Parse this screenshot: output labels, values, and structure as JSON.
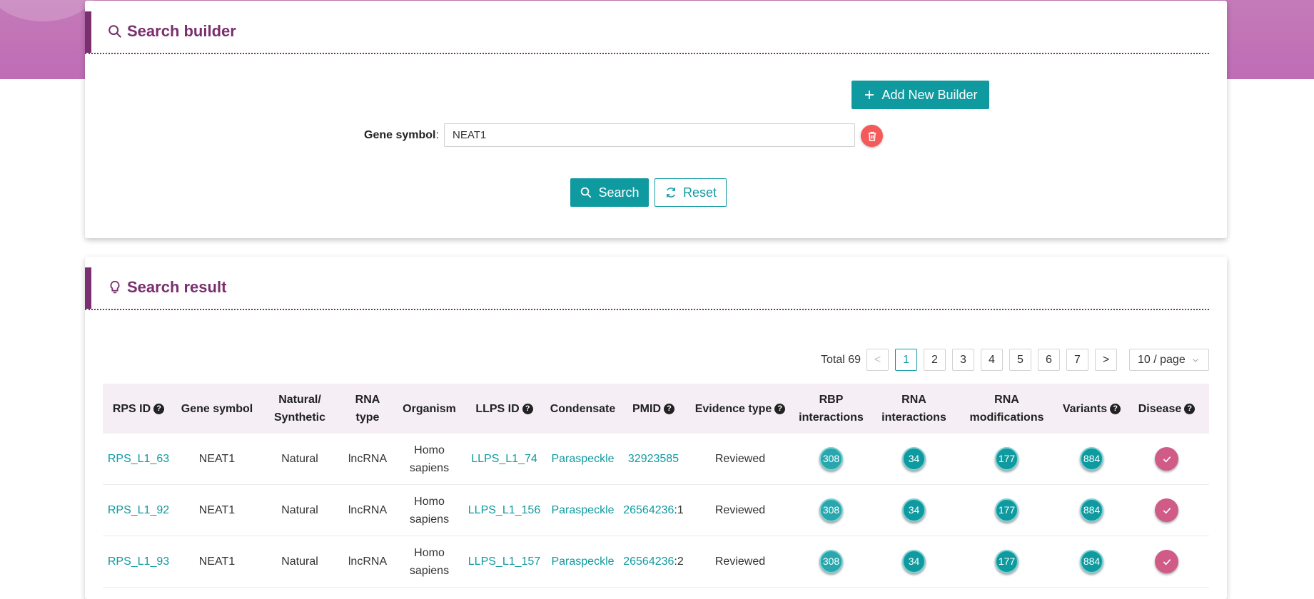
{
  "builder": {
    "title": "Search builder",
    "add_label": "Add New Builder",
    "field_label": "Gene symbol",
    "field_separator": ":",
    "field_value": "NEAT1",
    "search_label": "Search",
    "reset_label": "Reset"
  },
  "result": {
    "title": "Search result",
    "total_text": "Total 69",
    "pages": [
      "1",
      "2",
      "3",
      "4",
      "5",
      "6",
      "7"
    ],
    "prev_label": "<",
    "next_label": ">",
    "page_size": "10 / page",
    "columns": {
      "rps_id": "RPS ID",
      "gene_symbol": "Gene symbol",
      "natural_line1": "Natural/",
      "natural_line2": "Synthetic",
      "rna_type_line1": "RNA",
      "rna_type_line2": "type",
      "organism": "Organism",
      "llps_id": "LLPS ID",
      "condensate": "Condensate",
      "pmid": "PMID",
      "evidence": "Evidence type",
      "rbp_line1": "RBP",
      "rbp_line2": "interactions",
      "rnaint_line1": "RNA",
      "rnaint_line2": "interactions",
      "rnamod_line1": "RNA",
      "rnamod_line2": "modifications",
      "variants": "Variants",
      "disease": "Disease"
    },
    "rows": [
      {
        "rps_id": "RPS_L1_63",
        "gene": "NEAT1",
        "natural": "Natural",
        "rna_type": "lncRNA",
        "organism_line1": "Homo",
        "organism_line2": "sapiens",
        "llps_id": "LLPS_L1_74",
        "condensate": "Paraspeckle",
        "pmid": "32923585",
        "pmid_suffix": "",
        "evidence": "Reviewed",
        "rbp": "308",
        "rna_int": "34",
        "rna_mod": "177",
        "variants": "884"
      },
      {
        "rps_id": "RPS_L1_92",
        "gene": "NEAT1",
        "natural": "Natural",
        "rna_type": "lncRNA",
        "organism_line1": "Homo",
        "organism_line2": "sapiens",
        "llps_id": "LLPS_L1_156",
        "condensate": "Paraspeckle",
        "pmid": "26564236",
        "pmid_suffix": ":1",
        "evidence": "Reviewed",
        "rbp": "308",
        "rna_int": "34",
        "rna_mod": "177",
        "variants": "884"
      },
      {
        "rps_id": "RPS_L1_93",
        "gene": "NEAT1",
        "natural": "Natural",
        "rna_type": "lncRNA",
        "organism_line1": "Homo",
        "organism_line2": "sapiens",
        "llps_id": "LLPS_L1_157",
        "condensate": "Paraspeckle",
        "pmid": "26564236",
        "pmid_suffix": ":2",
        "evidence": "Reviewed",
        "rbp": "308",
        "rna_int": "34",
        "rna_mod": "177",
        "variants": "884"
      }
    ]
  },
  "icons": {
    "search_builder": "magnifier-icon",
    "search_result": "lightbulb-icon",
    "add": "plus-icon",
    "delete": "trash-icon",
    "search": "magnifier-icon",
    "reset": "refresh-icon",
    "help": "question-icon",
    "disease": "check-icon",
    "select": "chevron-down-icon"
  },
  "colors": {
    "brand_purple": "#7a2f6e",
    "header_band": "#c47ab9",
    "teal": "#0f9aa0",
    "danger": "#f45a5a",
    "disease": "#d05b87",
    "table_header_bg": "#f5eef5"
  }
}
